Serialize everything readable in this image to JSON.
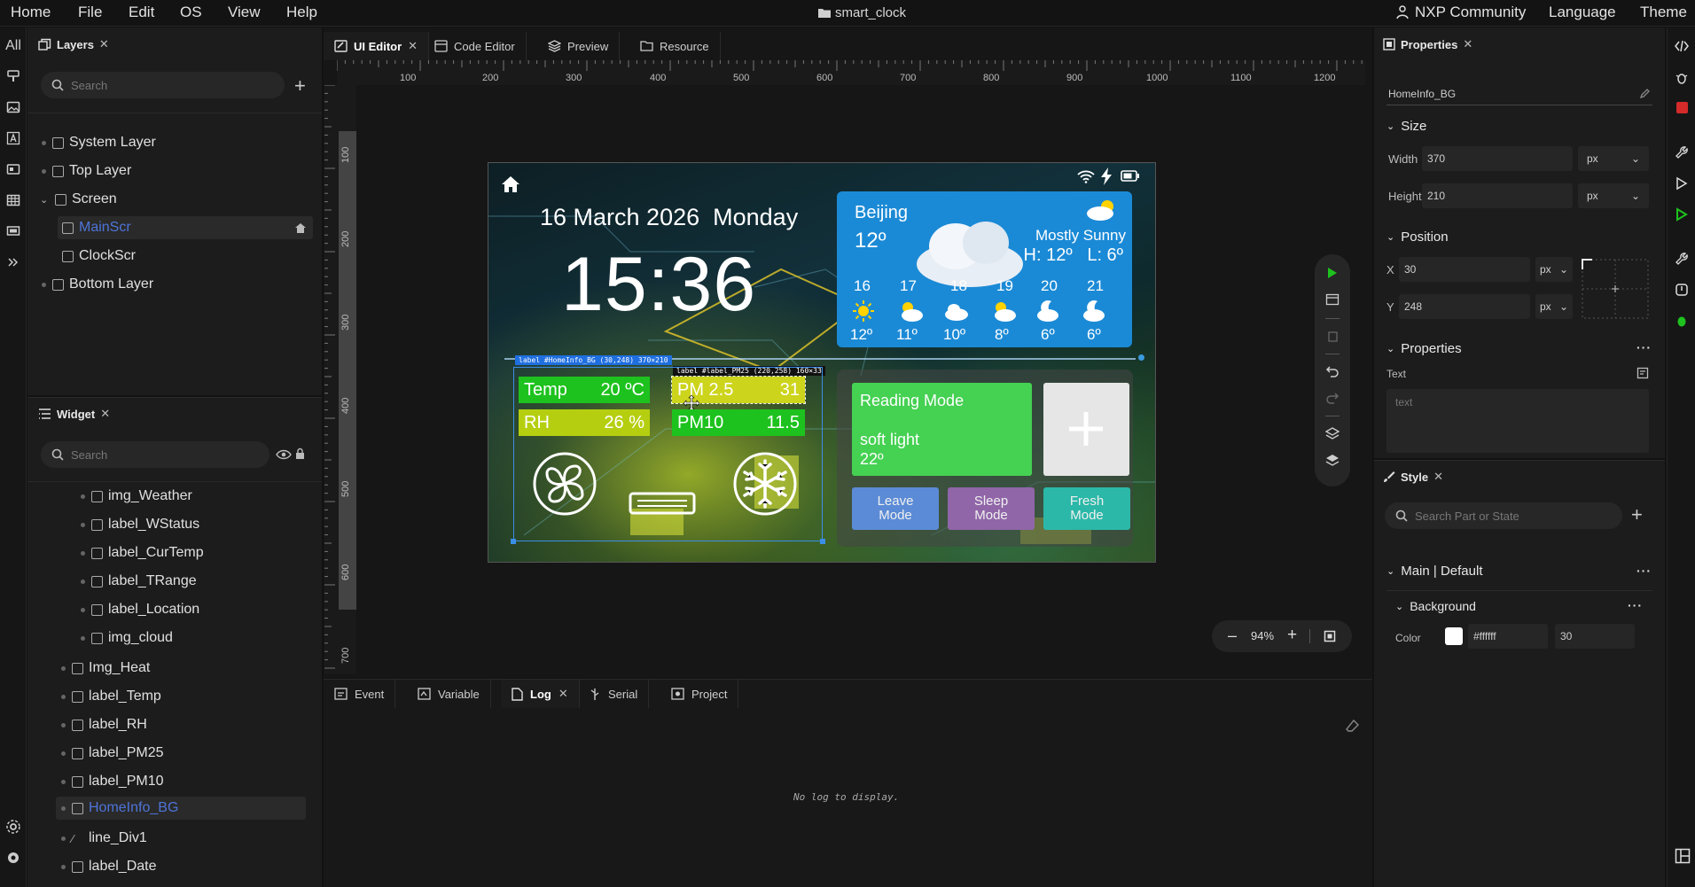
{
  "menu": {
    "items": [
      "Home",
      "File",
      "Edit",
      "OS",
      "View",
      "Help"
    ],
    "project": "smart_clock",
    "right": [
      "NXP Community",
      "Language",
      "Theme"
    ]
  },
  "rail": {
    "all_label": "All"
  },
  "layers": {
    "tab": "Layers",
    "search_placeholder": "Search",
    "tree": [
      {
        "label": "System Layer"
      },
      {
        "label": "Top Layer"
      },
      {
        "label": "Screen"
      },
      {
        "label": "MainScr"
      },
      {
        "label": "ClockScr"
      },
      {
        "label": "Bottom Layer"
      }
    ]
  },
  "widget": {
    "tab": "Widget",
    "search_placeholder": "Search",
    "tree": [
      {
        "label": "img_Weather"
      },
      {
        "label": "label_WStatus"
      },
      {
        "label": "label_CurTemp"
      },
      {
        "label": "label_TRange"
      },
      {
        "label": "label_Location"
      },
      {
        "label": "img_cloud"
      },
      {
        "label": "Img_Heat"
      },
      {
        "label": "label_Temp"
      },
      {
        "label": "label_RH"
      },
      {
        "label": "label_PM25"
      },
      {
        "label": "label_PM10"
      },
      {
        "label": "HomeInfo_BG"
      },
      {
        "label": "line_Div1"
      },
      {
        "label": "label_Date"
      }
    ]
  },
  "editor_tabs": [
    "UI Editor",
    "Code Editor",
    "Preview",
    "Resource"
  ],
  "ruler": {
    "h": [
      "100",
      "200",
      "300",
      "400",
      "500",
      "600",
      "700",
      "800",
      "900",
      "1000",
      "1100",
      "1200"
    ],
    "v": [
      "100",
      "200",
      "300",
      "400",
      "500",
      "600",
      "700"
    ]
  },
  "device": {
    "date": "16 March 2026",
    "weekday": "Monday",
    "time": "15:36",
    "weather": {
      "city": "Beijing",
      "temp": "12º",
      "status": "Mostly Sunny",
      "range": "H: 12º   L: 6º",
      "days": [
        "16",
        "17",
        "18",
        "19",
        "20",
        "21"
      ],
      "lows": [
        "12º",
        "11º",
        "10º",
        "8º",
        "6º",
        "6º"
      ]
    },
    "sel1": "label #HomeInfo_BG (30,248) 370×210",
    "sel2": "label #label_PM25 (220,258) 160×33",
    "temp_label": "Temp",
    "temp_value": "20 ºC",
    "rh_label": "RH",
    "rh_value": "26 %",
    "pm25_label": "PM 2.5",
    "pm25_value": "31",
    "pm10_label": "PM10",
    "pm10_value": "11.5",
    "reading_title": "Reading Mode",
    "reading_sub": "soft light",
    "reading_temp": "22º",
    "leave": "Leave\nMode",
    "sleep": "Sleep\nMode",
    "fresh": "Fresh\nMode",
    "colors": {
      "green": "#1ec21e",
      "yellow": "#cdd41c",
      "reading": "#45d152",
      "weather": "#1b8ad6",
      "leave": "#5b8bd6",
      "sleep": "#9066a8",
      "fresh": "#2bb8a8"
    }
  },
  "zoom": "94%",
  "bottom_tabs": [
    "Event",
    "Variable",
    "Log",
    "Serial",
    "Project"
  ],
  "log_empty": "No log to display.",
  "properties": {
    "tab": "Properties",
    "name_value": "HomeInfo_BG",
    "size_head": "Size",
    "width_label": "Width",
    "width_value": "370",
    "width_unit": "px",
    "height_label": "Height",
    "height_value": "210",
    "height_unit": "px",
    "position_head": "Position",
    "x_label": "X",
    "x_value": "30",
    "x_unit": "px",
    "y_label": "Y",
    "y_value": "248",
    "y_unit": "px",
    "props_head": "Properties",
    "text_label": "Text",
    "text_placeholder": "text"
  },
  "style": {
    "tab": "Style",
    "search_placeholder": "Search Part or State",
    "part_head": "Main | Default",
    "bg_head": "Background",
    "color_label": "Color",
    "color_value": "#ffffff",
    "opacity_value": "30"
  }
}
